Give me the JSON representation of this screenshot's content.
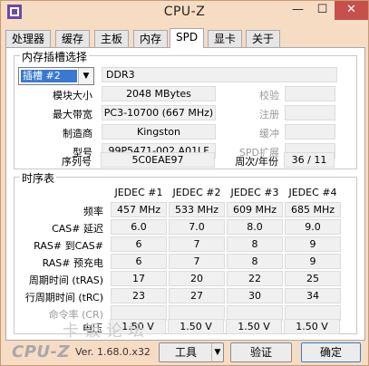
{
  "window": {
    "title": "CPU-Z",
    "minimize_glyph": "—",
    "maximize_glyph": "☐",
    "close_glyph": "✕",
    "icon": "cpu-z-app-icon"
  },
  "tabs": [
    {
      "label": "处理器"
    },
    {
      "label": "缓存"
    },
    {
      "label": "主板"
    },
    {
      "label": "内存"
    },
    {
      "label": "SPD"
    },
    {
      "label": "显卡"
    },
    {
      "label": "关于"
    }
  ],
  "active_tab": "SPD",
  "slot": {
    "group_title": "内存插槽选择",
    "selected": "插槽 #2",
    "type": "DDR3",
    "labels": {
      "module_size": "模块大小",
      "max_bandwidth": "最大带宽",
      "manufacturer": "制造商",
      "part_number": "型号",
      "serial": "序列号",
      "ecc": "校验",
      "registered": "注册",
      "buffered": "缓冲",
      "spd_ext": "SPD扩展",
      "week_year": "周次/年份"
    },
    "values": {
      "module_size": "2048 MBytes",
      "max_bandwidth": "PC3-10700 (667 MHz)",
      "manufacturer": "Kingston",
      "part_number": "99P5471-002.A01LF",
      "serial": "5C0EAE97",
      "week_year": "36 / 11"
    }
  },
  "timings": {
    "group_title": "时序表",
    "columns": [
      "JEDEC #1",
      "JEDEC #2",
      "JEDEC #3",
      "JEDEC #4"
    ],
    "rows": [
      {
        "label": "频率",
        "values": [
          "457 MHz",
          "533 MHz",
          "609 MHz",
          "685 MHz"
        ]
      },
      {
        "label": "CAS# 延迟",
        "values": [
          "6.0",
          "7.0",
          "8.0",
          "9.0"
        ]
      },
      {
        "label": "RAS# 到CAS#",
        "values": [
          "6",
          "7",
          "8",
          "9"
        ]
      },
      {
        "label": "RAS# 预充电",
        "values": [
          "6",
          "7",
          "8",
          "9"
        ]
      },
      {
        "label": "周期时间 (tRAS)",
        "values": [
          "17",
          "20",
          "22",
          "25"
        ]
      },
      {
        "label": "行周期时间 (tRC)",
        "values": [
          "23",
          "27",
          "30",
          "34"
        ]
      },
      {
        "label": "命令率 (CR)",
        "values": [
          "",
          "",
          "",
          ""
        ]
      },
      {
        "label": "电压",
        "values": [
          "1.50 V",
          "1.50 V",
          "1.50 V",
          "1.50 V"
        ]
      }
    ]
  },
  "footer": {
    "logo": "CPU-Z",
    "version": "Ver. 1.68.0.x32",
    "tools_label": "工具",
    "validate_label": "验证",
    "ok_label": "确定",
    "watermark": "卡饭论坛"
  }
}
